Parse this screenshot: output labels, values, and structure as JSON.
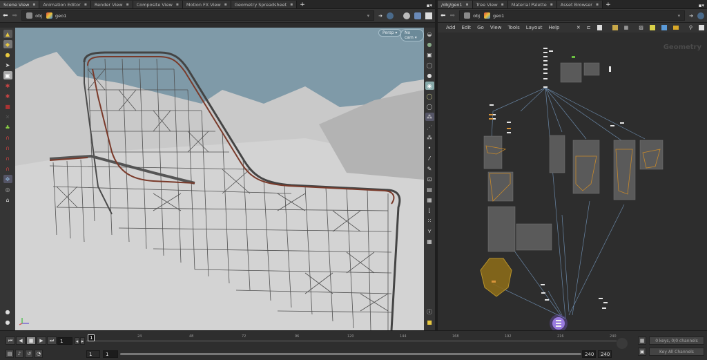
{
  "left_pane": {
    "tabs": [
      {
        "label": "Scene View",
        "active": true
      },
      {
        "label": "Animation Editor",
        "active": false
      },
      {
        "label": "Render View",
        "active": false
      },
      {
        "label": "Composite View",
        "active": false
      },
      {
        "label": "Motion FX View",
        "active": false
      },
      {
        "label": "Geometry Spreadsheet",
        "active": false
      }
    ],
    "path": {
      "crumb1": "obj",
      "crumb2": "geo1"
    },
    "viewport": {
      "camera_menu": "Persp",
      "cam_menu": "No cam"
    }
  },
  "right_pane": {
    "tabs": [
      {
        "label": "/obj/geo1",
        "active": true
      },
      {
        "label": "Tree View",
        "active": false
      },
      {
        "label": "Material Palette",
        "active": false
      },
      {
        "label": "Asset Browser",
        "active": false
      }
    ],
    "path": {
      "crumb1": "obj",
      "crumb2": "geo1"
    },
    "menu": [
      "Add",
      "Edit",
      "Go",
      "View",
      "Tools",
      "Layout",
      "Help"
    ],
    "network_label": "Geometry"
  },
  "timeline": {
    "current_frame": "1",
    "frame_marker": "1",
    "ticks": [
      "24",
      "48",
      "72",
      "96",
      "120",
      "144",
      "168",
      "192",
      "216",
      "240"
    ],
    "range_start": "1",
    "range_start2": "1",
    "range_end": "240",
    "range_end2": "240",
    "keys_status": "0 keys, 0/0 channels",
    "key_all_channels": "Key All Channels"
  },
  "colors": {
    "sky": "#7f9aa8",
    "network_bg": "#2d2d2d",
    "node_box": "#5a5a5a",
    "orange_group": "#c98a2a",
    "output_node": "#9a7be0"
  }
}
